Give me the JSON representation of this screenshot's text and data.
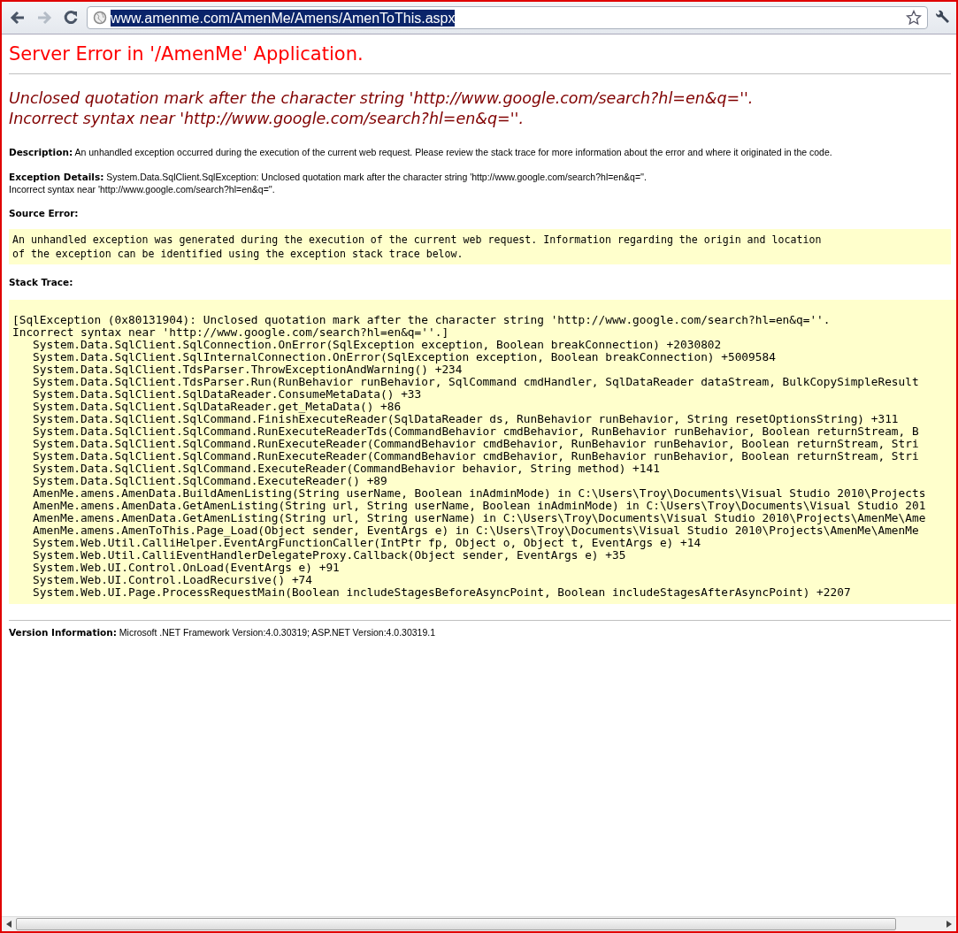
{
  "browser": {
    "url": "www.amenme.com/AmenMe/Amens/AmenToThis.aspx",
    "url_selected": true,
    "forward_disabled": true
  },
  "page": {
    "title": "Server Error in '/AmenMe' Application.",
    "message_lines": [
      "Unclosed quotation mark after the character string 'http://www.google.com/search?hl=en&q=''.",
      "Incorrect syntax near 'http://www.google.com/search?hl=en&q=''."
    ],
    "description": "**Description:** An unhandled exception occurred during the execution of the current web request. Please review the stack trace for more information about the error and where it originated in the code.",
    "exception_details": [
      "**Exception Details:** System.Data.SqlClient.SqlException: Unclosed quotation mark after the character string 'http://www.google.com/search?hl=en&q=''.",
      "Incorrect syntax near 'http://www.google.com/search?hl=en&q=''."
    ],
    "source_error": {
      "label": "Source Error:",
      "lines": [
        "An unhandled exception was generated during the execution of the current web request. Information regarding the origin and location",
        "of the exception can be identified using the exception stack trace below."
      ]
    },
    "stack_trace": {
      "label": "Stack Trace:",
      "lines": [
        "[SqlException (0x80131904): Unclosed quotation mark after the character string 'http://www.google.com/search?hl=en&q=''.",
        "Incorrect syntax near 'http://www.google.com/search?hl=en&q=''.]",
        "   System.Data.SqlClient.SqlConnection.OnError(SqlException exception, Boolean breakConnection) +2030802",
        "   System.Data.SqlClient.SqlInternalConnection.OnError(SqlException exception, Boolean breakConnection) +5009584",
        "   System.Data.SqlClient.TdsParser.ThrowExceptionAndWarning() +234",
        "   System.Data.SqlClient.TdsParser.Run(RunBehavior runBehavior, SqlCommand cmdHandler, SqlDataReader dataStream, BulkCopySimpleResult",
        "   System.Data.SqlClient.SqlDataReader.ConsumeMetaData() +33",
        "   System.Data.SqlClient.SqlDataReader.get_MetaData() +86",
        "   System.Data.SqlClient.SqlCommand.FinishExecuteReader(SqlDataReader ds, RunBehavior runBehavior, String resetOptionsString) +311",
        "   System.Data.SqlClient.SqlCommand.RunExecuteReaderTds(CommandBehavior cmdBehavior, RunBehavior runBehavior, Boolean returnStream, B",
        "   System.Data.SqlClient.SqlCommand.RunExecuteReader(CommandBehavior cmdBehavior, RunBehavior runBehavior, Boolean returnStream, Stri",
        "   System.Data.SqlClient.SqlCommand.RunExecuteReader(CommandBehavior cmdBehavior, RunBehavior runBehavior, Boolean returnStream, Stri",
        "   System.Data.SqlClient.SqlCommand.ExecuteReader(CommandBehavior behavior, String method) +141",
        "   System.Data.SqlClient.SqlCommand.ExecuteReader() +89",
        "   AmenMe.amens.AmenData.BuildAmenListing(String userName, Boolean inAdminMode) in C:\\Users\\Troy\\Documents\\Visual Studio 2010\\Projects",
        "   AmenMe.amens.AmenData.GetAmenListing(String url, String userName, Boolean inAdminMode) in C:\\Users\\Troy\\Documents\\Visual Studio 201",
        "   AmenMe.amens.AmenData.GetAmenListing(String url, String userName) in C:\\Users\\Troy\\Documents\\Visual Studio 2010\\Projects\\AmenMe\\Ame",
        "   AmenMe.amens.AmenToThis.Page_Load(Object sender, EventArgs e) in C:\\Users\\Troy\\Documents\\Visual Studio 2010\\Projects\\AmenMe\\AmenMe",
        "   System.Web.Util.CalliHelper.EventArgFunctionCaller(IntPtr fp, Object o, Object t, EventArgs e) +14",
        "   System.Web.Util.CalliEventHandlerDelegateProxy.Callback(Object sender, EventArgs e) +35",
        "   System.Web.UI.Control.OnLoad(EventArgs e) +91",
        "   System.Web.UI.Control.LoadRecursive() +74",
        "   System.Web.UI.Page.ProcessRequestMain(Boolean includeStagesBeforeAsyncPoint, Boolean includeStagesAfterAsyncPoint) +2207"
      ]
    },
    "version_information": "**Version Information:** Microsoft .NET Framework Version:4.0.30319; ASP.NET Version:4.0.30319.1"
  }
}
